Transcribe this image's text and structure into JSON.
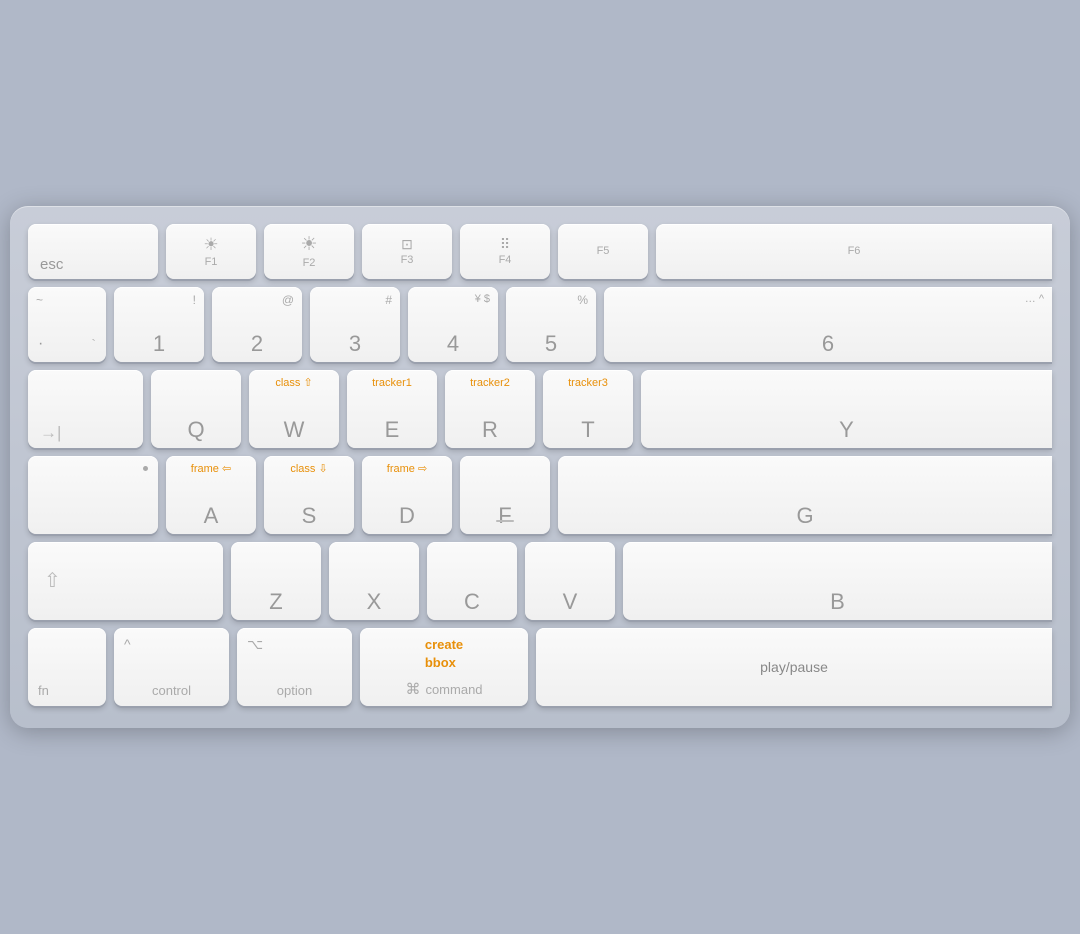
{
  "keyboard": {
    "rows": {
      "row1": {
        "keys": [
          {
            "id": "esc",
            "main": "esc",
            "sub": "",
            "icon": ""
          },
          {
            "id": "f1",
            "main": "F1",
            "sub": "",
            "icon": "brightness-low"
          },
          {
            "id": "f2",
            "main": "F2",
            "sub": "",
            "icon": "brightness-high"
          },
          {
            "id": "f3",
            "main": "F3",
            "sub": "",
            "icon": "mission-control"
          },
          {
            "id": "f4",
            "main": "F4",
            "sub": "",
            "icon": "launchpad"
          },
          {
            "id": "f5",
            "main": "F5",
            "sub": "",
            "icon": ""
          },
          {
            "id": "f6",
            "main": "F6",
            "sub": "",
            "icon": ""
          }
        ]
      },
      "row2": {
        "keys": [
          {
            "id": "tilde",
            "main": "·",
            "tl": "~",
            "num": ""
          },
          {
            "id": "1",
            "main": "1",
            "num": "!"
          },
          {
            "id": "2",
            "main": "2",
            "num": "@"
          },
          {
            "id": "3",
            "main": "3",
            "num": "#"
          },
          {
            "id": "4",
            "main": "4",
            "num": "¥  $"
          },
          {
            "id": "5",
            "main": "5",
            "num": "%"
          },
          {
            "id": "6",
            "main": "6",
            "num": "…  ^"
          }
        ]
      },
      "row3": {
        "keys": [
          {
            "id": "tab",
            "main": "→|",
            "orange": "",
            "letter": ""
          },
          {
            "id": "q",
            "main": "Q",
            "orange": ""
          },
          {
            "id": "w",
            "main": "W",
            "orange": "class ⇧"
          },
          {
            "id": "e",
            "main": "E",
            "orange": "tracker1"
          },
          {
            "id": "r",
            "main": "R",
            "orange": "tracker2"
          },
          {
            "id": "t",
            "main": "T",
            "orange": "tracker3"
          },
          {
            "id": "y",
            "main": "Y",
            "orange": ""
          }
        ]
      },
      "row4": {
        "keys": [
          {
            "id": "caps",
            "main": "",
            "orange": ""
          },
          {
            "id": "a",
            "main": "A",
            "orange": "frame ⇦"
          },
          {
            "id": "s",
            "main": "S",
            "orange": "class ⇩"
          },
          {
            "id": "d",
            "main": "D",
            "orange": "frame ⇨"
          },
          {
            "id": "f",
            "main": "F",
            "orange": ""
          },
          {
            "id": "g",
            "main": "G",
            "orange": ""
          }
        ]
      },
      "row5": {
        "keys": [
          {
            "id": "shift-l",
            "main": "⇧",
            "orange": ""
          },
          {
            "id": "z",
            "main": "Z",
            "orange": ""
          },
          {
            "id": "x",
            "main": "X",
            "orange": ""
          },
          {
            "id": "c",
            "main": "C",
            "orange": ""
          },
          {
            "id": "v",
            "main": "V",
            "orange": ""
          },
          {
            "id": "b",
            "main": "B",
            "orange": ""
          }
        ]
      },
      "row6": {
        "fn_label": "fn",
        "control_sym": "^",
        "control_label": "control",
        "option_sym": "⌥",
        "option_label": "option",
        "command_orange1": "create",
        "command_orange2": "bbox",
        "command_sym": "⌘",
        "command_label": "command",
        "space_orange": "play/pause"
      }
    }
  }
}
